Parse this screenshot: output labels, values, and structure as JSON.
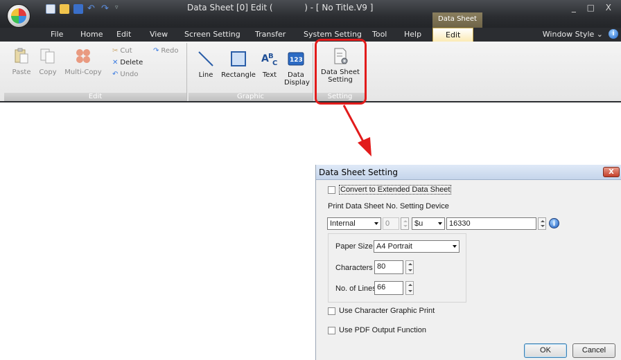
{
  "app": {
    "window_title": "Data Sheet [0] Edit (            ) - [ No Title.V9 ]",
    "context_tab_group": "Data Sheet",
    "window_buttons": "_ □ X",
    "window_style_label": "Window Style",
    "menu": [
      "File",
      "Home",
      "Edit",
      "View",
      "Screen Setting",
      "Transfer",
      "System Setting",
      "Tool",
      "Help",
      "Edit"
    ],
    "ribbon": {
      "groups": {
        "edit": {
          "label": "Edit",
          "paste": "Paste",
          "copy": "Copy",
          "multi_copy": "Multi-Copy",
          "cut": "Cut",
          "delete": "Delete",
          "undo": "Undo",
          "redo": "Redo"
        },
        "graphic": {
          "label": "Graphic",
          "line": "Line",
          "rectangle": "Rectangle",
          "text": "Text",
          "data_display_1": "Data",
          "data_display_2": "Display"
        },
        "setting": {
          "label": "Setting",
          "data_sheet_setting_1": "Data Sheet",
          "data_sheet_setting_2": "Setting"
        }
      }
    }
  },
  "dialog": {
    "title": "Data Sheet Setting",
    "close_label": "X",
    "convert_extended": "Convert to Extended Data Sheet",
    "print_device_label": "Print Data Sheet No. Setting Device",
    "device_type": "Internal",
    "device_index": "0",
    "device_prefix": "$u",
    "device_address": "16330",
    "paper_size_label": "Paper Size",
    "paper_size_value": "A4 Portrait",
    "characters_label": "Characters",
    "characters_value": "80",
    "lines_label": "No. of Lines",
    "lines_value": "66",
    "use_char_graphic": "Use Character Graphic Print",
    "use_pdf": "Use PDF Output Function",
    "ok": "OK",
    "cancel": "Cancel"
  },
  "colors": {
    "highlight": "#e21b1b",
    "titlebar": "#2b2d31",
    "ribbon_bg": "#f0f0f0"
  }
}
